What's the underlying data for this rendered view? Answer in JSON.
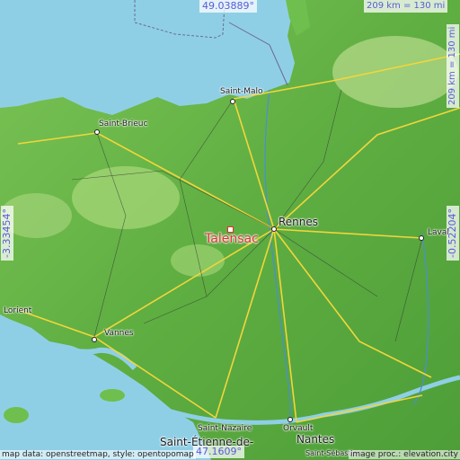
{
  "map": {
    "marker_name": "Talensac",
    "marker_color": "#e03030",
    "coordinates": {
      "north": "49.03889°",
      "south": "47.1609°",
      "west": "-3.33454°",
      "east": "-0.52204°"
    },
    "scale": {
      "horizontal": "209 km = 130 mi",
      "vertical": "209 km = 130 mi"
    },
    "attribution": {
      "left": "map data: openstreetmap, style: opentopomap",
      "right": "image proc.: elevation.city"
    },
    "cities": [
      {
        "name": "Rennes"
      },
      {
        "name": "Saint-Malo"
      },
      {
        "name": "Saint-Brieuc"
      },
      {
        "name": "Laval"
      },
      {
        "name": "Lorient"
      },
      {
        "name": "Vannes"
      },
      {
        "name": "Saint-Nazaire"
      },
      {
        "name": "Orvault"
      },
      {
        "name": "Nantes"
      },
      {
        "name": "Saint-Étienne-de-"
      },
      {
        "name": "Saint-Sébastien"
      }
    ]
  }
}
